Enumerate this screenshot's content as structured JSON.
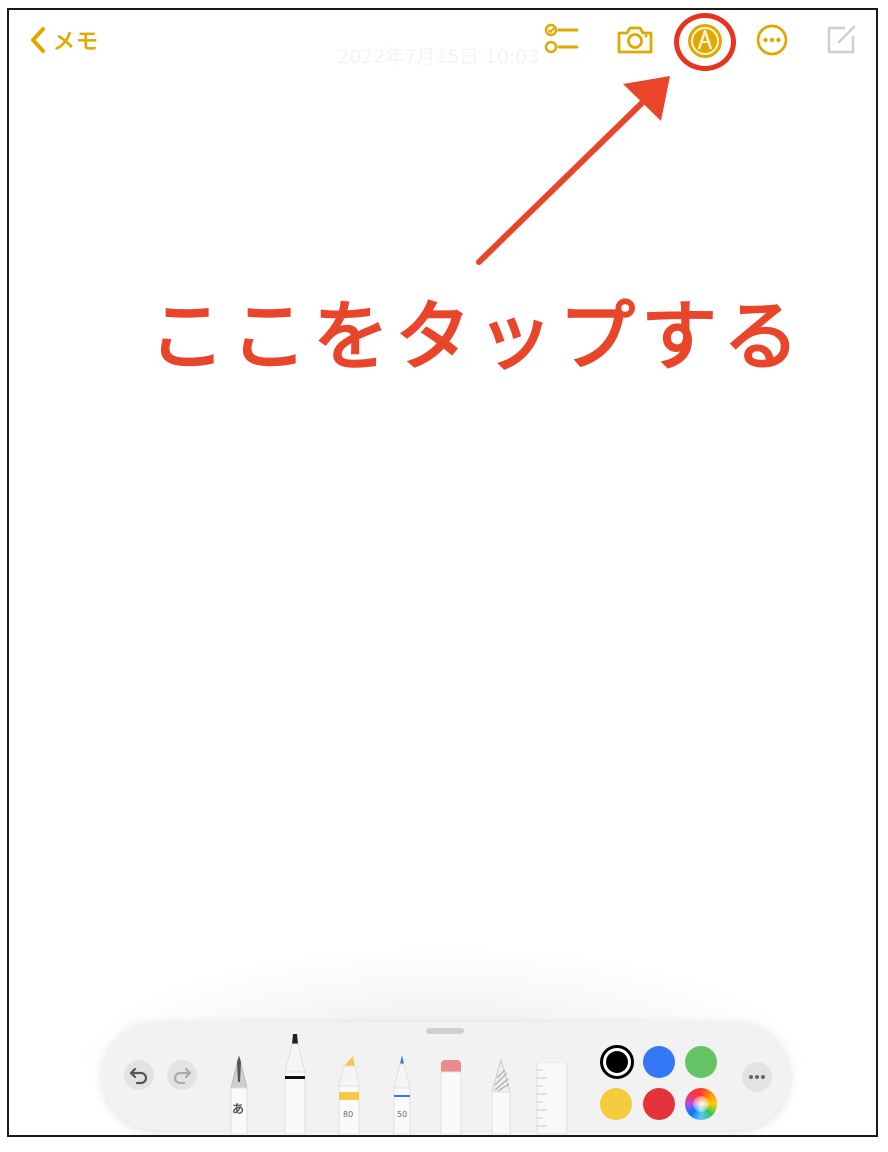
{
  "nav": {
    "back_label": "メモ"
  },
  "note": {
    "date": "2022年7月15日 10:03"
  },
  "toolbar": {
    "icons": [
      "checklist-icon",
      "camera-icon",
      "markup-icon",
      "more-icon",
      "compose-icon"
    ],
    "accent": "#e0a800"
  },
  "annotation": {
    "text": "ここをタップする",
    "color": "#e8452b"
  },
  "palette": {
    "pen_label": "あ",
    "highlighter_label": "80",
    "pen2_label": "50",
    "colors": {
      "black": "#000000",
      "blue": "#3478f6",
      "green": "#65c466",
      "yellow": "#f6cc3f",
      "red": "#e5333b"
    }
  }
}
